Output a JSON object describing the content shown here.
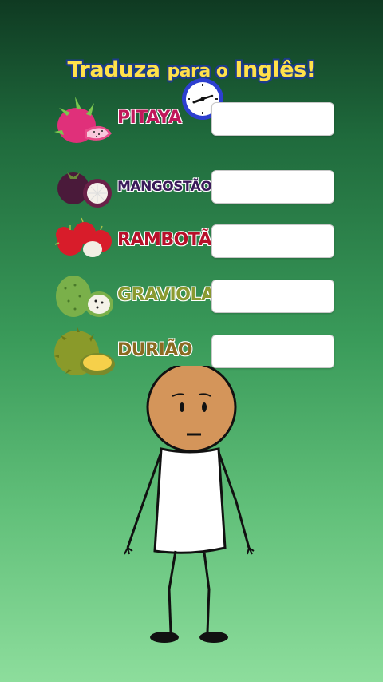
{
  "header": {
    "title_part1": "Traduza",
    "title_part2": "para o",
    "title_part3": "Inglês!",
    "timer_icon": "clock-icon"
  },
  "colors": {
    "title_fill": "#ffe14a",
    "title_outline": "#1c3c8a",
    "pitaya": "#c0185a",
    "mangostao": "#3a1a5a",
    "rambota": "#b8102a",
    "graviola": "#8a9a30",
    "duriao": "#8a6a20"
  },
  "fruits": [
    {
      "label": "PITAYA",
      "icon": "dragon-fruit-icon",
      "answer": ""
    },
    {
      "label": "MANGOSTÃO",
      "icon": "mangosteen-icon",
      "answer": ""
    },
    {
      "label": "RAMBOTÃ",
      "icon": "rambutan-icon",
      "answer": ""
    },
    {
      "label": "GRAVIOLA",
      "icon": "soursop-icon",
      "answer": ""
    },
    {
      "label": "DURIÃO",
      "icon": "durian-icon",
      "answer": ""
    }
  ],
  "character": {
    "icon": "stick-figure-character"
  }
}
